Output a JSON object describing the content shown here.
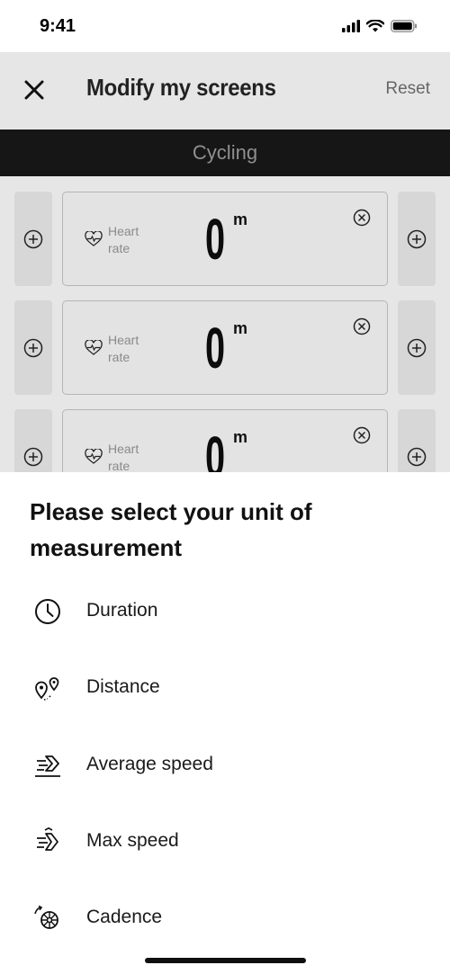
{
  "status_bar": {
    "time": "9:41"
  },
  "header": {
    "title": "Modify my screens",
    "reset_label": "Reset"
  },
  "sport": {
    "label": "Cycling"
  },
  "screen_rows": [
    {
      "metric_label": "Heart rate",
      "value": "0",
      "unit": "m"
    },
    {
      "metric_label": "Heart rate",
      "value": "0",
      "unit": "m"
    },
    {
      "metric_label": "Heart rate",
      "value": "0",
      "unit": "m"
    }
  ],
  "sheet": {
    "title": "Please select your unit of measurement",
    "options": [
      {
        "label": "Duration",
        "icon": "clock-icon"
      },
      {
        "label": "Distance",
        "icon": "route-pins-icon"
      },
      {
        "label": "Average speed",
        "icon": "average-speed-icon"
      },
      {
        "label": "Max speed",
        "icon": "max-speed-icon"
      },
      {
        "label": "Cadence",
        "icon": "cadence-icon"
      }
    ]
  },
  "colors": {
    "overlay_bg": "#e6e6e6",
    "sport_bar_bg": "#161616",
    "sheet_bg": "#ffffff"
  }
}
